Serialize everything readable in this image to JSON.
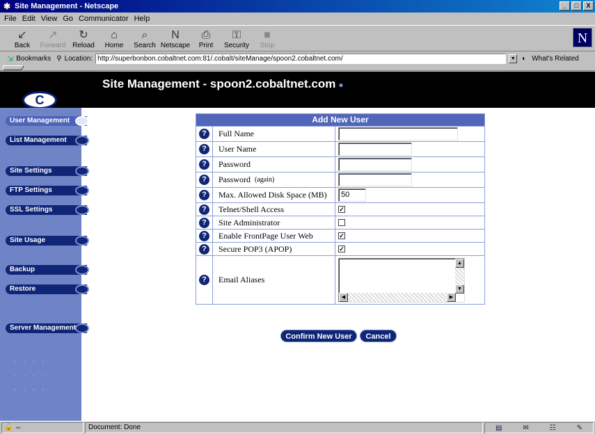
{
  "window": {
    "title": "Site Management - Netscape",
    "buttons": [
      "_",
      "□",
      "X"
    ]
  },
  "menu": [
    "File",
    "Edit",
    "View",
    "Go",
    "Communicator",
    "Help"
  ],
  "toolbar": [
    {
      "label": "Back",
      "icon": "↙"
    },
    {
      "label": "Forward",
      "icon": "↗"
    },
    {
      "label": "Reload",
      "icon": "↻"
    },
    {
      "label": "Home",
      "icon": "⌂"
    },
    {
      "label": "Search",
      "icon": "⌕"
    },
    {
      "label": "Netscape",
      "icon": "N"
    },
    {
      "label": "Print",
      "icon": "⎙"
    },
    {
      "label": "Security",
      "icon": "⚿"
    },
    {
      "label": "Stop",
      "icon": "■"
    }
  ],
  "location": {
    "bookmarks": "Bookmarks",
    "label": "Location:",
    "url": "http://superbonbon.cobaltnet.com:81/.cobalt/siteManage/spoon2.cobaltnet.com/",
    "related": "What's Related"
  },
  "page": {
    "title": "Site Management - spoon2.cobaltnet.com",
    "logo": "C"
  },
  "nav": [
    {
      "label": "User Management"
    },
    {
      "label": "List Management"
    },
    {
      "label": "Site Settings"
    },
    {
      "label": "FTP Settings"
    },
    {
      "label": "SSL Settings"
    },
    {
      "label": "Site Usage"
    },
    {
      "label": "Backup"
    },
    {
      "label": "Restore"
    },
    {
      "label": "Server Management"
    }
  ],
  "form": {
    "title": "Add New User",
    "help": "?",
    "fields": {
      "full_name": {
        "label": "Full Name",
        "value": ""
      },
      "user_name": {
        "label": "User Name",
        "value": ""
      },
      "password": {
        "label": "Password",
        "value": ""
      },
      "password_again": {
        "label": "Password",
        "hint": "(again)",
        "value": ""
      },
      "disk_space": {
        "label": "Max. Allowed Disk Space (MB)",
        "value": "50"
      },
      "telnet": {
        "label": "Telnet/Shell Access",
        "checked": true
      },
      "site_admin": {
        "label": "Site Administrator",
        "checked": false
      },
      "frontpage": {
        "label": "Enable FrontPage User Web",
        "checked": true
      },
      "apop": {
        "label": "Secure POP3 (APOP)",
        "checked": true
      },
      "email_aliases": {
        "label": "Email Aliases",
        "value": ""
      }
    },
    "confirm": "Confirm New User",
    "cancel": "Cancel"
  },
  "status": {
    "text": "Document: Done"
  }
}
